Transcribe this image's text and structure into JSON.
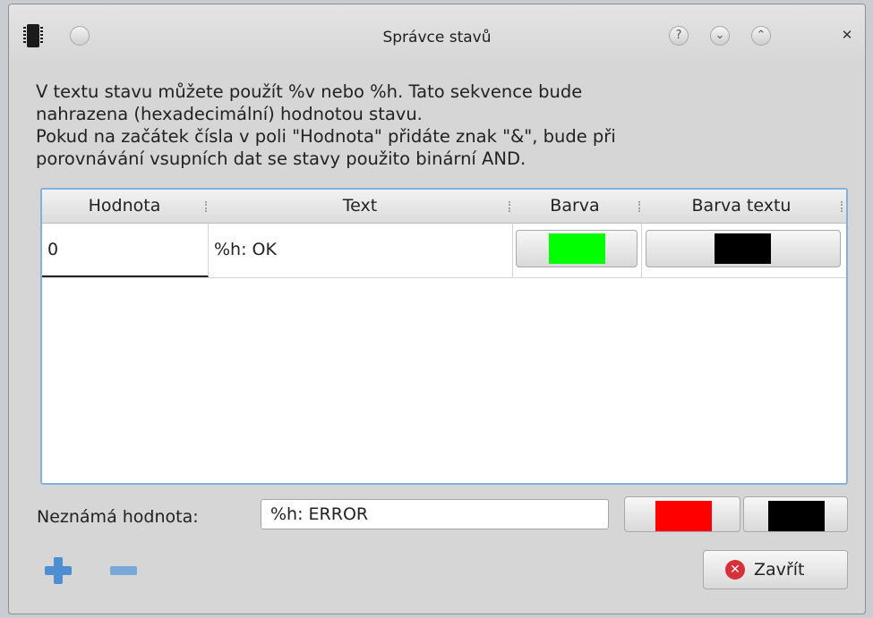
{
  "window": {
    "title": "Správce stavů",
    "titlebar_buttons": {
      "help": "?",
      "minimize": "⌄",
      "maximize": "⌃",
      "close": "✕"
    }
  },
  "description": {
    "line1": "V textu stavu můžete použít %v nebo %h. Tato sekvence bude",
    "line2": "nahrazena (hexadecimální) hodnotou stavu.",
    "line3": "Pokud na začátek čísla v poli \"Hodnota\" přidáte znak \"&\", bude při",
    "line4": "porovnávání vsupních dat se stavy použito binární AND."
  },
  "table": {
    "columns": [
      "Hodnota",
      "Text",
      "Barva",
      "Barva textu"
    ],
    "rows": [
      {
        "value": "0",
        "text": "%h: OK",
        "color": "#00ff00",
        "text_color": "#000000"
      }
    ]
  },
  "unknown": {
    "label": "Neznámá hodnota:",
    "value": "%h: ERROR",
    "color": "#ff0000",
    "text_color": "#000000"
  },
  "actions": {
    "add_icon": "plus-icon",
    "remove_icon": "minus-icon",
    "close_label": "Zavřít",
    "close_icon": "error-icon"
  }
}
